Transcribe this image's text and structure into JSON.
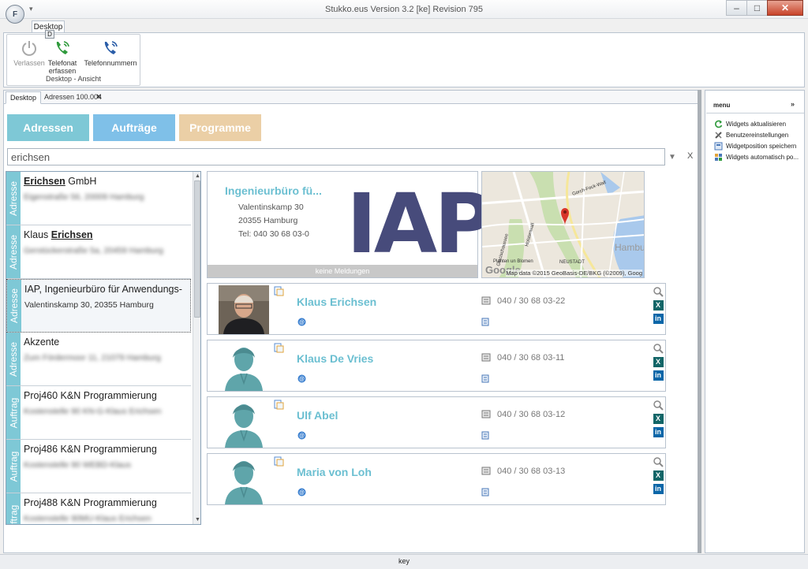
{
  "window": {
    "title": "Stukko.eus Version 3.2 [ke] Revision 795",
    "orb_letter": "F",
    "minimize": "–",
    "maximize": "□",
    "close": "✕"
  },
  "ribbon": {
    "tab": "Desktop",
    "keytip": "D",
    "buttons": {
      "leave": "Verlassen",
      "log_call": "Telefonat erfassen",
      "phone_numbers": "Telefonnummern"
    },
    "group_label": "Desktop - Ansicht"
  },
  "doc_tabs": {
    "active": "Desktop",
    "other": "Adressen 100.004",
    "close": "×"
  },
  "category_buttons": [
    {
      "label": "Adressen",
      "color": "#7ec8d6"
    },
    {
      "label": "Aufträge",
      "color": "#7fc0e8"
    },
    {
      "label": "Programme",
      "color": "#ebcfa6"
    }
  ],
  "search": {
    "value": "erichsen",
    "dropdown": "▼",
    "clear": "X"
  },
  "results": [
    {
      "tag": "Adresse",
      "title_pre": "",
      "title_bold": "Erichsen",
      "title_post": " GmbH",
      "sub": "Eigenstraße 56, 20009 Hamburg",
      "sub_blurred": true
    },
    {
      "tag": "Adresse",
      "title_pre": "Klaus ",
      "title_bold": "Erichsen",
      "title_post": "",
      "sub": "Gerstückerstraße 5a, 20459 Hamburg",
      "sub_blurred": true
    },
    {
      "tag": "Adresse",
      "title_pre": "IAP, Ingenieurbüro für Anwendungs-",
      "title_bold": "",
      "title_post": "",
      "sub": "Valentinskamp 30, 20355 Hamburg",
      "sub_blurred": false
    },
    {
      "tag": "Adresse",
      "title_pre": "Akzente",
      "title_bold": "",
      "title_post": "",
      "sub": "Zum Fördermoor 11, 21079 Hamburg",
      "sub_blurred": true
    },
    {
      "tag": "Auftrag",
      "title_pre": "Proj460 K&N Programmierung",
      "title_bold": "",
      "title_post": "",
      "sub": "Kostenstelle 90 KN-G-Klaus Erichsen",
      "sub_blurred": true
    },
    {
      "tag": "Auftrag",
      "title_pre": "Proj486 K&N Programmierung",
      "title_bold": "",
      "title_post": "",
      "sub": "Kostenstelle 90 WEBD-Klaus",
      "sub_blurred": true
    },
    {
      "tag": "Auftrag",
      "title_pre": "Proj488 K&N Programmierung",
      "title_bold": "",
      "title_post": "",
      "sub": "Kostenstelle 90MU-Klaus Erichsen",
      "sub_blurred": true
    }
  ],
  "company": {
    "name": "Ingenieurbüro fü...",
    "street": "Valentinskamp 30",
    "city": "20355 Hamburg",
    "phone": "Tel: 040 30 68 03-0",
    "logo": "IAP",
    "status": "keine Meldungen"
  },
  "map": {
    "credit": "Map data ©2015 GeoBasis-DE/BKG (©2009), Goog",
    "google": "Google",
    "labels": [
      "Gorch-Fock-Wall",
      "Holstenwall",
      "Glacischaussee",
      "Planten un Blomen",
      "NEUSTADT",
      "Hambu"
    ]
  },
  "contacts": [
    {
      "name": "Klaus Erichsen",
      "phone": "040 / 30 68 03-22",
      "photo": true
    },
    {
      "name": "Klaus De Vries",
      "phone": "040 / 30 68 03-11",
      "photo": false
    },
    {
      "name": "Ulf Abel",
      "phone": "040 / 30 68 03-12",
      "photo": false
    },
    {
      "name": "Maria von Loh",
      "phone": "040 / 30 68 03-13",
      "photo": false
    }
  ],
  "menu": {
    "title": "menu",
    "collapse": "»",
    "items": [
      {
        "label": "Widgets aktualisieren",
        "icon": "refresh-icon"
      },
      {
        "label": "Benutzereinstellungen",
        "icon": "tools-icon"
      },
      {
        "label": "Widgetposition speichern",
        "icon": "save-layout-icon"
      },
      {
        "label": "Widgets automatisch po...",
        "icon": "auto-layout-icon"
      }
    ]
  },
  "statusbar": {
    "text": "key"
  }
}
